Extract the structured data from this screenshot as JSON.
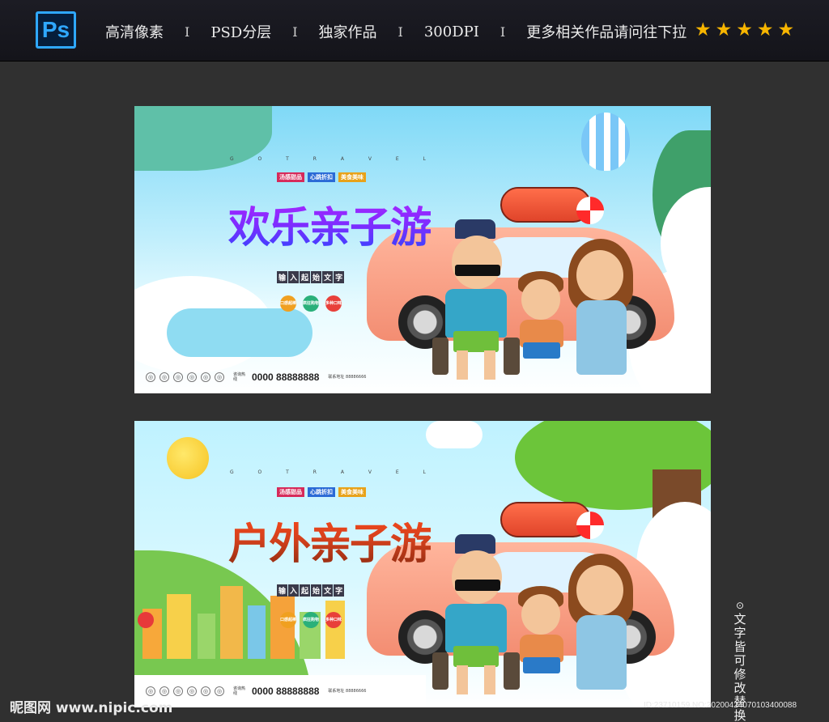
{
  "topbar": {
    "logo_text": "Ps",
    "items": [
      "高清像素",
      "PSD分层",
      "独家作品",
      "300DPI",
      "更多相关作品请问往下拉"
    ],
    "separator": "I",
    "star_glyph": "★",
    "star_count": 5,
    "star_color": "#f7b500"
  },
  "banners": [
    {
      "tagline": "G O T R A V E L",
      "tags": [
        "汤感甜品",
        "心跳折扣",
        "美食美味"
      ],
      "title": "欢乐亲子游",
      "subtitle": [
        "输",
        "入",
        "起",
        "始",
        "文",
        "字"
      ],
      "circles": [
        "口感超棒",
        "疯狂购物",
        "多种口味"
      ],
      "phone_label": "咨询热线",
      "phone": "0000 88888888",
      "address": "联系地址 88886666"
    },
    {
      "tagline": "G O T R A V E L",
      "tags": [
        "汤感甜品",
        "心跳折扣",
        "美食美味"
      ],
      "title": "户外亲子游",
      "subtitle": [
        "输",
        "入",
        "起",
        "始",
        "文",
        "字"
      ],
      "circles": [
        "口感超棒",
        "疯狂购物",
        "多种口味"
      ],
      "phone_label": "咨询热线",
      "phone": "0000 88888888",
      "address": "联系地址 88886666"
    }
  ],
  "side_note": "文字皆可修改替换",
  "watermark_left": "昵图网 www.nipic.com",
  "watermark_right": "ID:23710159 NO:20200424070103400088",
  "colors": {
    "page_bg": "#303030",
    "ps_blue": "#2fa8ff",
    "title1_purple": "#7a2dff",
    "title2_orange": "#d2401c"
  }
}
